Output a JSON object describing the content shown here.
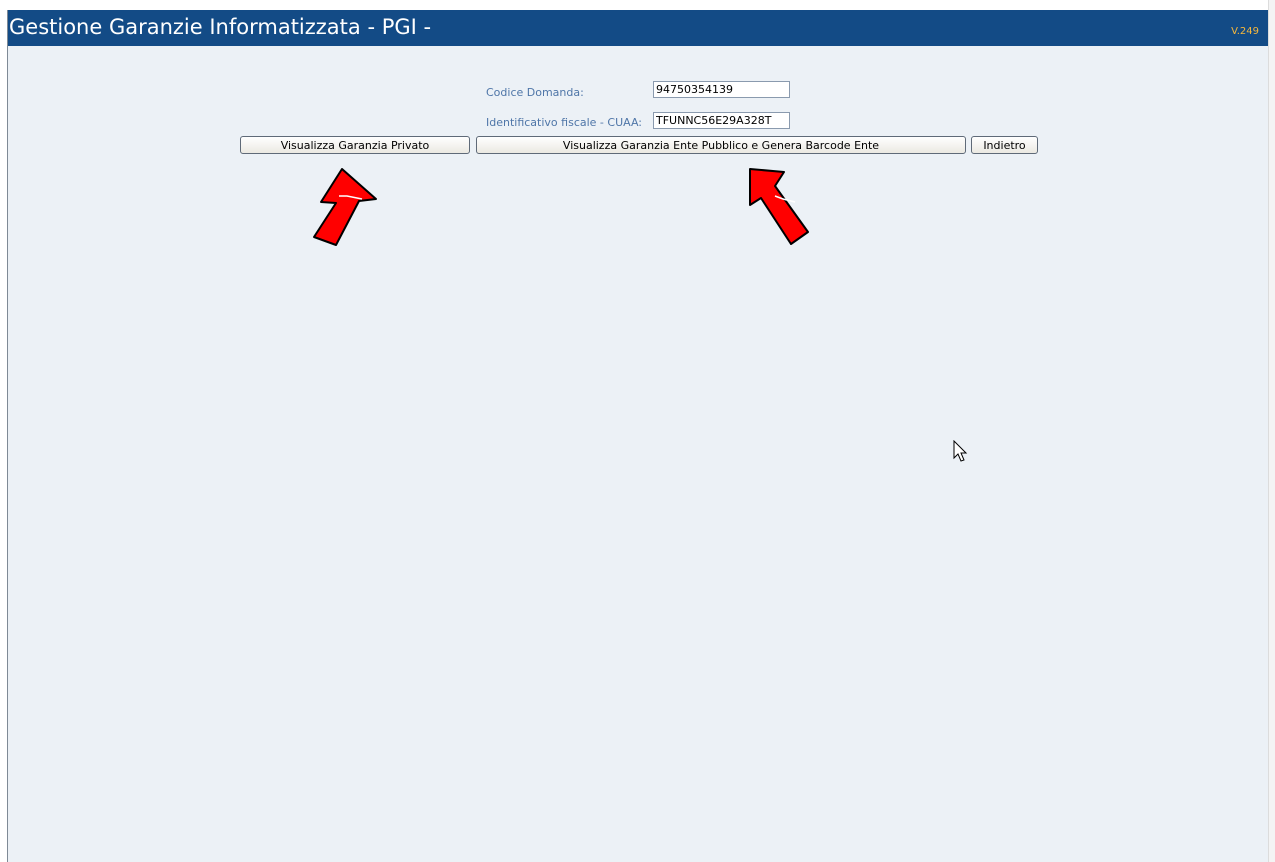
{
  "header": {
    "title": "Gestione Garanzie Informatizzata - PGI -",
    "version": "V.249"
  },
  "form": {
    "codice_domanda": {
      "label": "Codice Domanda:",
      "value": "94750354139"
    },
    "cuaa": {
      "label": "Identificativo fiscale - CUAA:",
      "value": "TFUNNC56E29A328T"
    }
  },
  "actions": {
    "privato_label": "Visualizza Garanzia Privato",
    "ente_label": "Visualizza Garanzia Ente Pubblico e Genera Barcode Ente",
    "indietro_label": "Indietro"
  },
  "annotations": {
    "arrow_color": "#ff0000",
    "arrow_icon": "red-arrow-icon"
  },
  "colors": {
    "header_bg": "#134b86",
    "page_bg": "#ecf1f6",
    "label_color": "#4f76a8",
    "version_color": "#f6b73c"
  }
}
